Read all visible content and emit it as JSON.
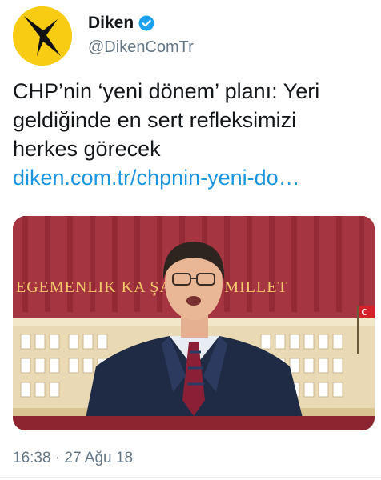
{
  "account": {
    "display_name": "Diken",
    "handle": "@DikenComTr",
    "verified": true,
    "avatar_icon": "diken-logo-icon",
    "avatar_color": "#f7cc12"
  },
  "tweet": {
    "lines": [
      "CHP’nin ‘yeni dönem’ planı: Yeri",
      "geldiğinde en sert refleksimizi",
      "herkes görecek"
    ],
    "link": "diken.com.tr/chpnin-yeni-do…",
    "link_color": "#1b95e0"
  },
  "media": {
    "banner_text": "EGEMENLIK KA    ŞARTSIZ MILLET"
  },
  "timestamp": "16:38 · 27 Ağu 18",
  "colors": {
    "text": "#14171a",
    "secondary": "#657786",
    "verified": "#1da1f2"
  }
}
